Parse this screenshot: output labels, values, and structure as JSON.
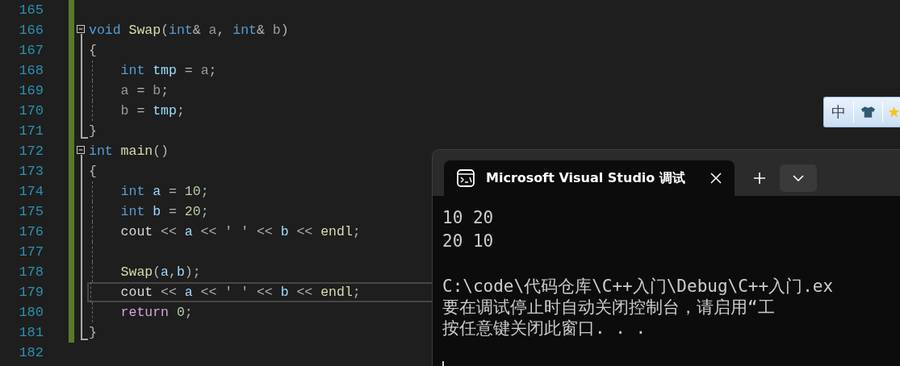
{
  "editor": {
    "lines": [
      {
        "number": "165",
        "changed": true,
        "current": false,
        "indent_guide": false,
        "indented": false
      },
      {
        "number": "166",
        "changed": true,
        "current": false,
        "indent_guide": false,
        "indented": false,
        "fold": {
          "kind": "start",
          "expanded": true
        },
        "tokens": [
          {
            "kind": "keyword",
            "text": "void "
          },
          {
            "kind": "function",
            "text": "Swap"
          },
          {
            "kind": "punct",
            "text": "("
          },
          {
            "kind": "keyword",
            "text": "int"
          },
          {
            "kind": "punct",
            "text": "& "
          },
          {
            "kind": "param",
            "text": "a"
          },
          {
            "kind": "punct",
            "text": ", "
          },
          {
            "kind": "keyword",
            "text": "int"
          },
          {
            "kind": "punct",
            "text": "& "
          },
          {
            "kind": "param",
            "text": "b"
          },
          {
            "kind": "punct",
            "text": ")"
          }
        ]
      },
      {
        "number": "167",
        "changed": true,
        "current": false,
        "indent_guide": false,
        "indented": false,
        "fold": {
          "kind": "body"
        },
        "tokens": [
          {
            "kind": "punct",
            "text": "{"
          }
        ]
      },
      {
        "number": "168",
        "changed": true,
        "current": false,
        "indent_guide": true,
        "indented": true,
        "fold": {
          "kind": "body"
        },
        "tokens": [
          {
            "kind": "keyword",
            "text": "int "
          },
          {
            "kind": "local",
            "text": "tmp"
          },
          {
            "kind": "punct",
            "text": " = "
          },
          {
            "kind": "param",
            "text": "a"
          },
          {
            "kind": "punct",
            "text": ";"
          }
        ]
      },
      {
        "number": "169",
        "changed": true,
        "current": false,
        "indent_guide": true,
        "indented": true,
        "fold": {
          "kind": "body"
        },
        "tokens": [
          {
            "kind": "param",
            "text": "a"
          },
          {
            "kind": "punct",
            "text": " = "
          },
          {
            "kind": "param",
            "text": "b"
          },
          {
            "kind": "punct",
            "text": ";"
          }
        ]
      },
      {
        "number": "170",
        "changed": true,
        "current": false,
        "indent_guide": true,
        "indented": true,
        "fold": {
          "kind": "body"
        },
        "tokens": [
          {
            "kind": "param",
            "text": "b"
          },
          {
            "kind": "punct",
            "text": " = "
          },
          {
            "kind": "local",
            "text": "tmp"
          },
          {
            "kind": "punct",
            "text": ";"
          }
        ]
      },
      {
        "number": "171",
        "changed": true,
        "current": false,
        "indent_guide": false,
        "indented": false,
        "fold": {
          "kind": "end"
        },
        "tokens": [
          {
            "kind": "punct",
            "text": "}"
          }
        ]
      },
      {
        "number": "172",
        "changed": true,
        "current": false,
        "indent_guide": false,
        "indented": false,
        "fold": {
          "kind": "start",
          "expanded": true
        },
        "tokens": [
          {
            "kind": "keyword",
            "text": "int "
          },
          {
            "kind": "function",
            "text": "main"
          },
          {
            "kind": "punct",
            "text": "()"
          }
        ]
      },
      {
        "number": "173",
        "changed": true,
        "current": false,
        "indent_guide": false,
        "indented": false,
        "fold": {
          "kind": "body"
        },
        "tokens": [
          {
            "kind": "punct",
            "text": "{"
          }
        ]
      },
      {
        "number": "174",
        "changed": true,
        "current": false,
        "indent_guide": true,
        "indented": true,
        "fold": {
          "kind": "body"
        },
        "tokens": [
          {
            "kind": "keyword",
            "text": "int "
          },
          {
            "kind": "local",
            "text": "a"
          },
          {
            "kind": "punct",
            "text": " = "
          },
          {
            "kind": "number",
            "text": "10"
          },
          {
            "kind": "punct",
            "text": ";"
          }
        ]
      },
      {
        "number": "175",
        "changed": true,
        "current": false,
        "indent_guide": true,
        "indented": true,
        "fold": {
          "kind": "body"
        },
        "tokens": [
          {
            "kind": "keyword",
            "text": "int "
          },
          {
            "kind": "local",
            "text": "b"
          },
          {
            "kind": "punct",
            "text": " = "
          },
          {
            "kind": "number",
            "text": "20"
          },
          {
            "kind": "punct",
            "text": ";"
          }
        ]
      },
      {
        "number": "176",
        "changed": true,
        "current": false,
        "indent_guide": true,
        "indented": true,
        "fold": {
          "kind": "body"
        },
        "tokens": [
          {
            "kind": "plain",
            "text": "cout"
          },
          {
            "kind": "punct",
            "text": " << "
          },
          {
            "kind": "local",
            "text": "a"
          },
          {
            "kind": "punct",
            "text": " << "
          },
          {
            "kind": "string",
            "text": "' '"
          },
          {
            "kind": "punct",
            "text": " << "
          },
          {
            "kind": "local",
            "text": "b"
          },
          {
            "kind": "punct",
            "text": " << "
          },
          {
            "kind": "function",
            "text": "endl"
          },
          {
            "kind": "punct",
            "text": ";"
          }
        ]
      },
      {
        "number": "177",
        "changed": true,
        "current": false,
        "indent_guide": true,
        "indented": false,
        "fold": {
          "kind": "body"
        }
      },
      {
        "number": "178",
        "changed": true,
        "current": false,
        "indent_guide": true,
        "indented": true,
        "fold": {
          "kind": "body"
        },
        "tokens": [
          {
            "kind": "function",
            "text": "Swap"
          },
          {
            "kind": "punct",
            "text": "("
          },
          {
            "kind": "local",
            "text": "a"
          },
          {
            "kind": "punct",
            "text": ","
          },
          {
            "kind": "local",
            "text": "b"
          },
          {
            "kind": "punct",
            "text": ");"
          }
        ]
      },
      {
        "number": "179",
        "changed": true,
        "current": true,
        "indent_guide": true,
        "indented": true,
        "fold": {
          "kind": "body"
        },
        "tokens": [
          {
            "kind": "plain",
            "text": "cout"
          },
          {
            "kind": "punct",
            "text": " << "
          },
          {
            "kind": "local",
            "text": "a"
          },
          {
            "kind": "punct",
            "text": " << "
          },
          {
            "kind": "string",
            "text": "' '"
          },
          {
            "kind": "punct",
            "text": " << "
          },
          {
            "kind": "local",
            "text": "b"
          },
          {
            "kind": "punct",
            "text": " << "
          },
          {
            "kind": "function",
            "text": "endl"
          },
          {
            "kind": "punct",
            "text": ";"
          }
        ]
      },
      {
        "number": "180",
        "changed": true,
        "current": false,
        "indent_guide": true,
        "indented": true,
        "fold": {
          "kind": "body"
        },
        "tokens": [
          {
            "kind": "control",
            "text": "return "
          },
          {
            "kind": "number",
            "text": "0"
          },
          {
            "kind": "punct",
            "text": ";"
          }
        ]
      },
      {
        "number": "181",
        "changed": true,
        "current": false,
        "indent_guide": false,
        "indented": false,
        "fold": {
          "kind": "end"
        },
        "tokens": [
          {
            "kind": "punct",
            "text": "}"
          }
        ]
      },
      {
        "number": "182",
        "changed": false,
        "current": false,
        "indent_guide": false,
        "indented": false
      }
    ]
  },
  "ime_toolbar": {
    "mode_label": "中"
  },
  "console": {
    "tab": {
      "title": "Microsoft Visual Studio 调试",
      "selected": true
    },
    "output_blocks": [
      [
        "10 20",
        "20 10"
      ],
      [
        "C:\\code\\代码仓库\\C++入门\\Debug\\C++入门.ex",
        "要在调试停止时自动关闭控制台，请启用“工",
        "按任意键关闭此窗口. . ."
      ]
    ]
  }
}
